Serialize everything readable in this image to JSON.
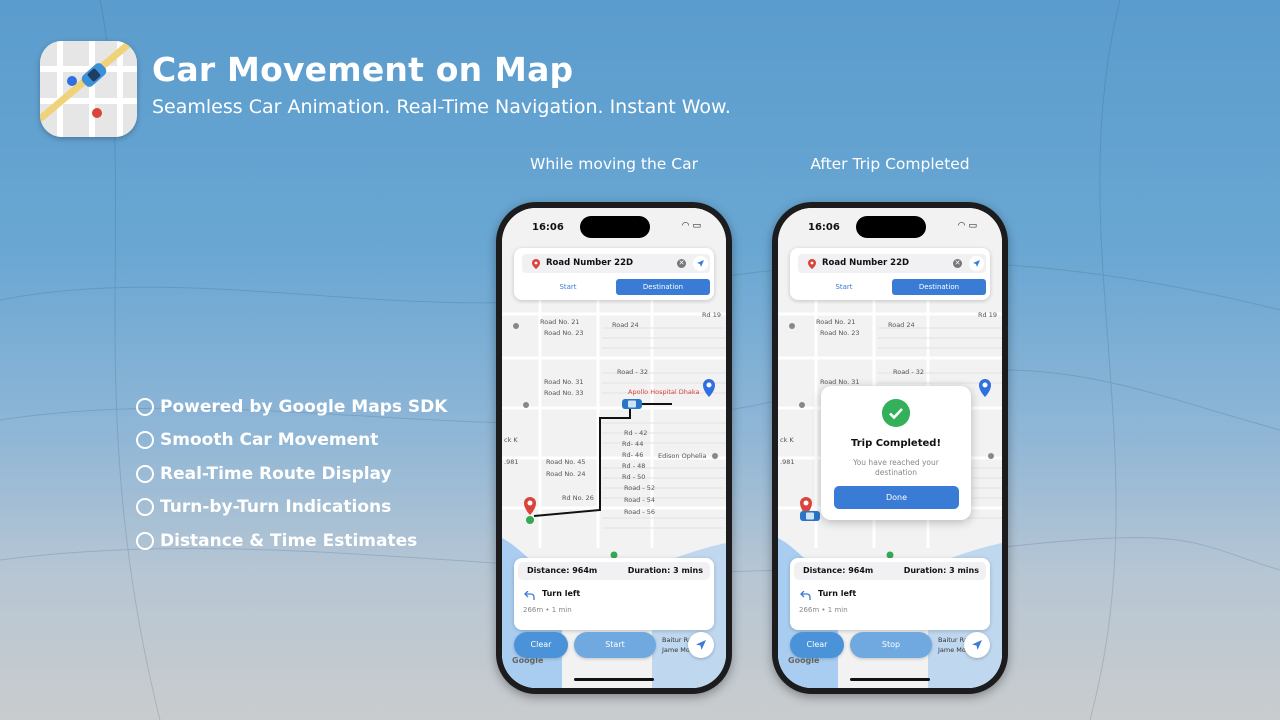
{
  "header": {
    "title": "Car Movement on Map",
    "subtitle": "Seamless Car Animation. Real-Time Navigation. Instant Wow."
  },
  "features": [
    "Powered by Google Maps SDK",
    "Smooth Car Movement",
    "Real-Time Route Display",
    "Turn-by-Turn Indications",
    "Distance & Time Estimates"
  ],
  "screens": [
    {
      "caption": "While moving the Car",
      "time": "16:06",
      "search_value": "Road Number 22D",
      "tab_start": "Start",
      "tab_destination": "Destination",
      "distance": "Distance: 964m",
      "duration": "Duration: 3 mins",
      "turn": "Turn left",
      "turn_sub": "266m • 1 min",
      "clear_label": "Clear",
      "action_label": "Start",
      "google": "Google"
    },
    {
      "caption": "After Trip Completed",
      "time": "16:06",
      "search_value": "Road Number 22D",
      "tab_start": "Start",
      "tab_destination": "Destination",
      "distance": "Distance: 964m",
      "duration": "Duration: 3 mins",
      "turn": "Turn left",
      "turn_sub": "266m • 1 min",
      "clear_label": "Clear",
      "action_label": "Stop",
      "google": "Google",
      "modal": {
        "title": "Trip Completed!",
        "message": "You have reached your destination",
        "done_label": "Done"
      }
    }
  ],
  "map_labels": {
    "road21": "Road No. 21",
    "road23": "Road No. 23",
    "road24": "Road 24",
    "rd19": "Rd 19",
    "road32": "Road - 32",
    "road31": "Road No. 31",
    "road33": "Road No. 33",
    "apollo": "Apollo Hospital Dhaka",
    "rd42": "Rd - 42",
    "rd44": "Rd- 44",
    "rd46": "Rd- 46",
    "rd48": "Rd - 48",
    "rd50": "Rd - 50",
    "rd52": "Road - 52",
    "rd54": "Road - 54",
    "rd56": "Road - 56",
    "road45": "Road No. 45",
    "road24b": "Road No. 24",
    "rd26": "Rd No. 26",
    "edison": "Edison Ophelia",
    "block": "ck K",
    "n981": ".981",
    "baitur": "Baitur Ra",
    "jame": "Jame Mo"
  },
  "colors": {
    "accent": "#3a7bd5",
    "route": "#111111",
    "pin_red": "#d9453a",
    "pin_blue": "#2f6fe0",
    "success": "#34b05a"
  }
}
